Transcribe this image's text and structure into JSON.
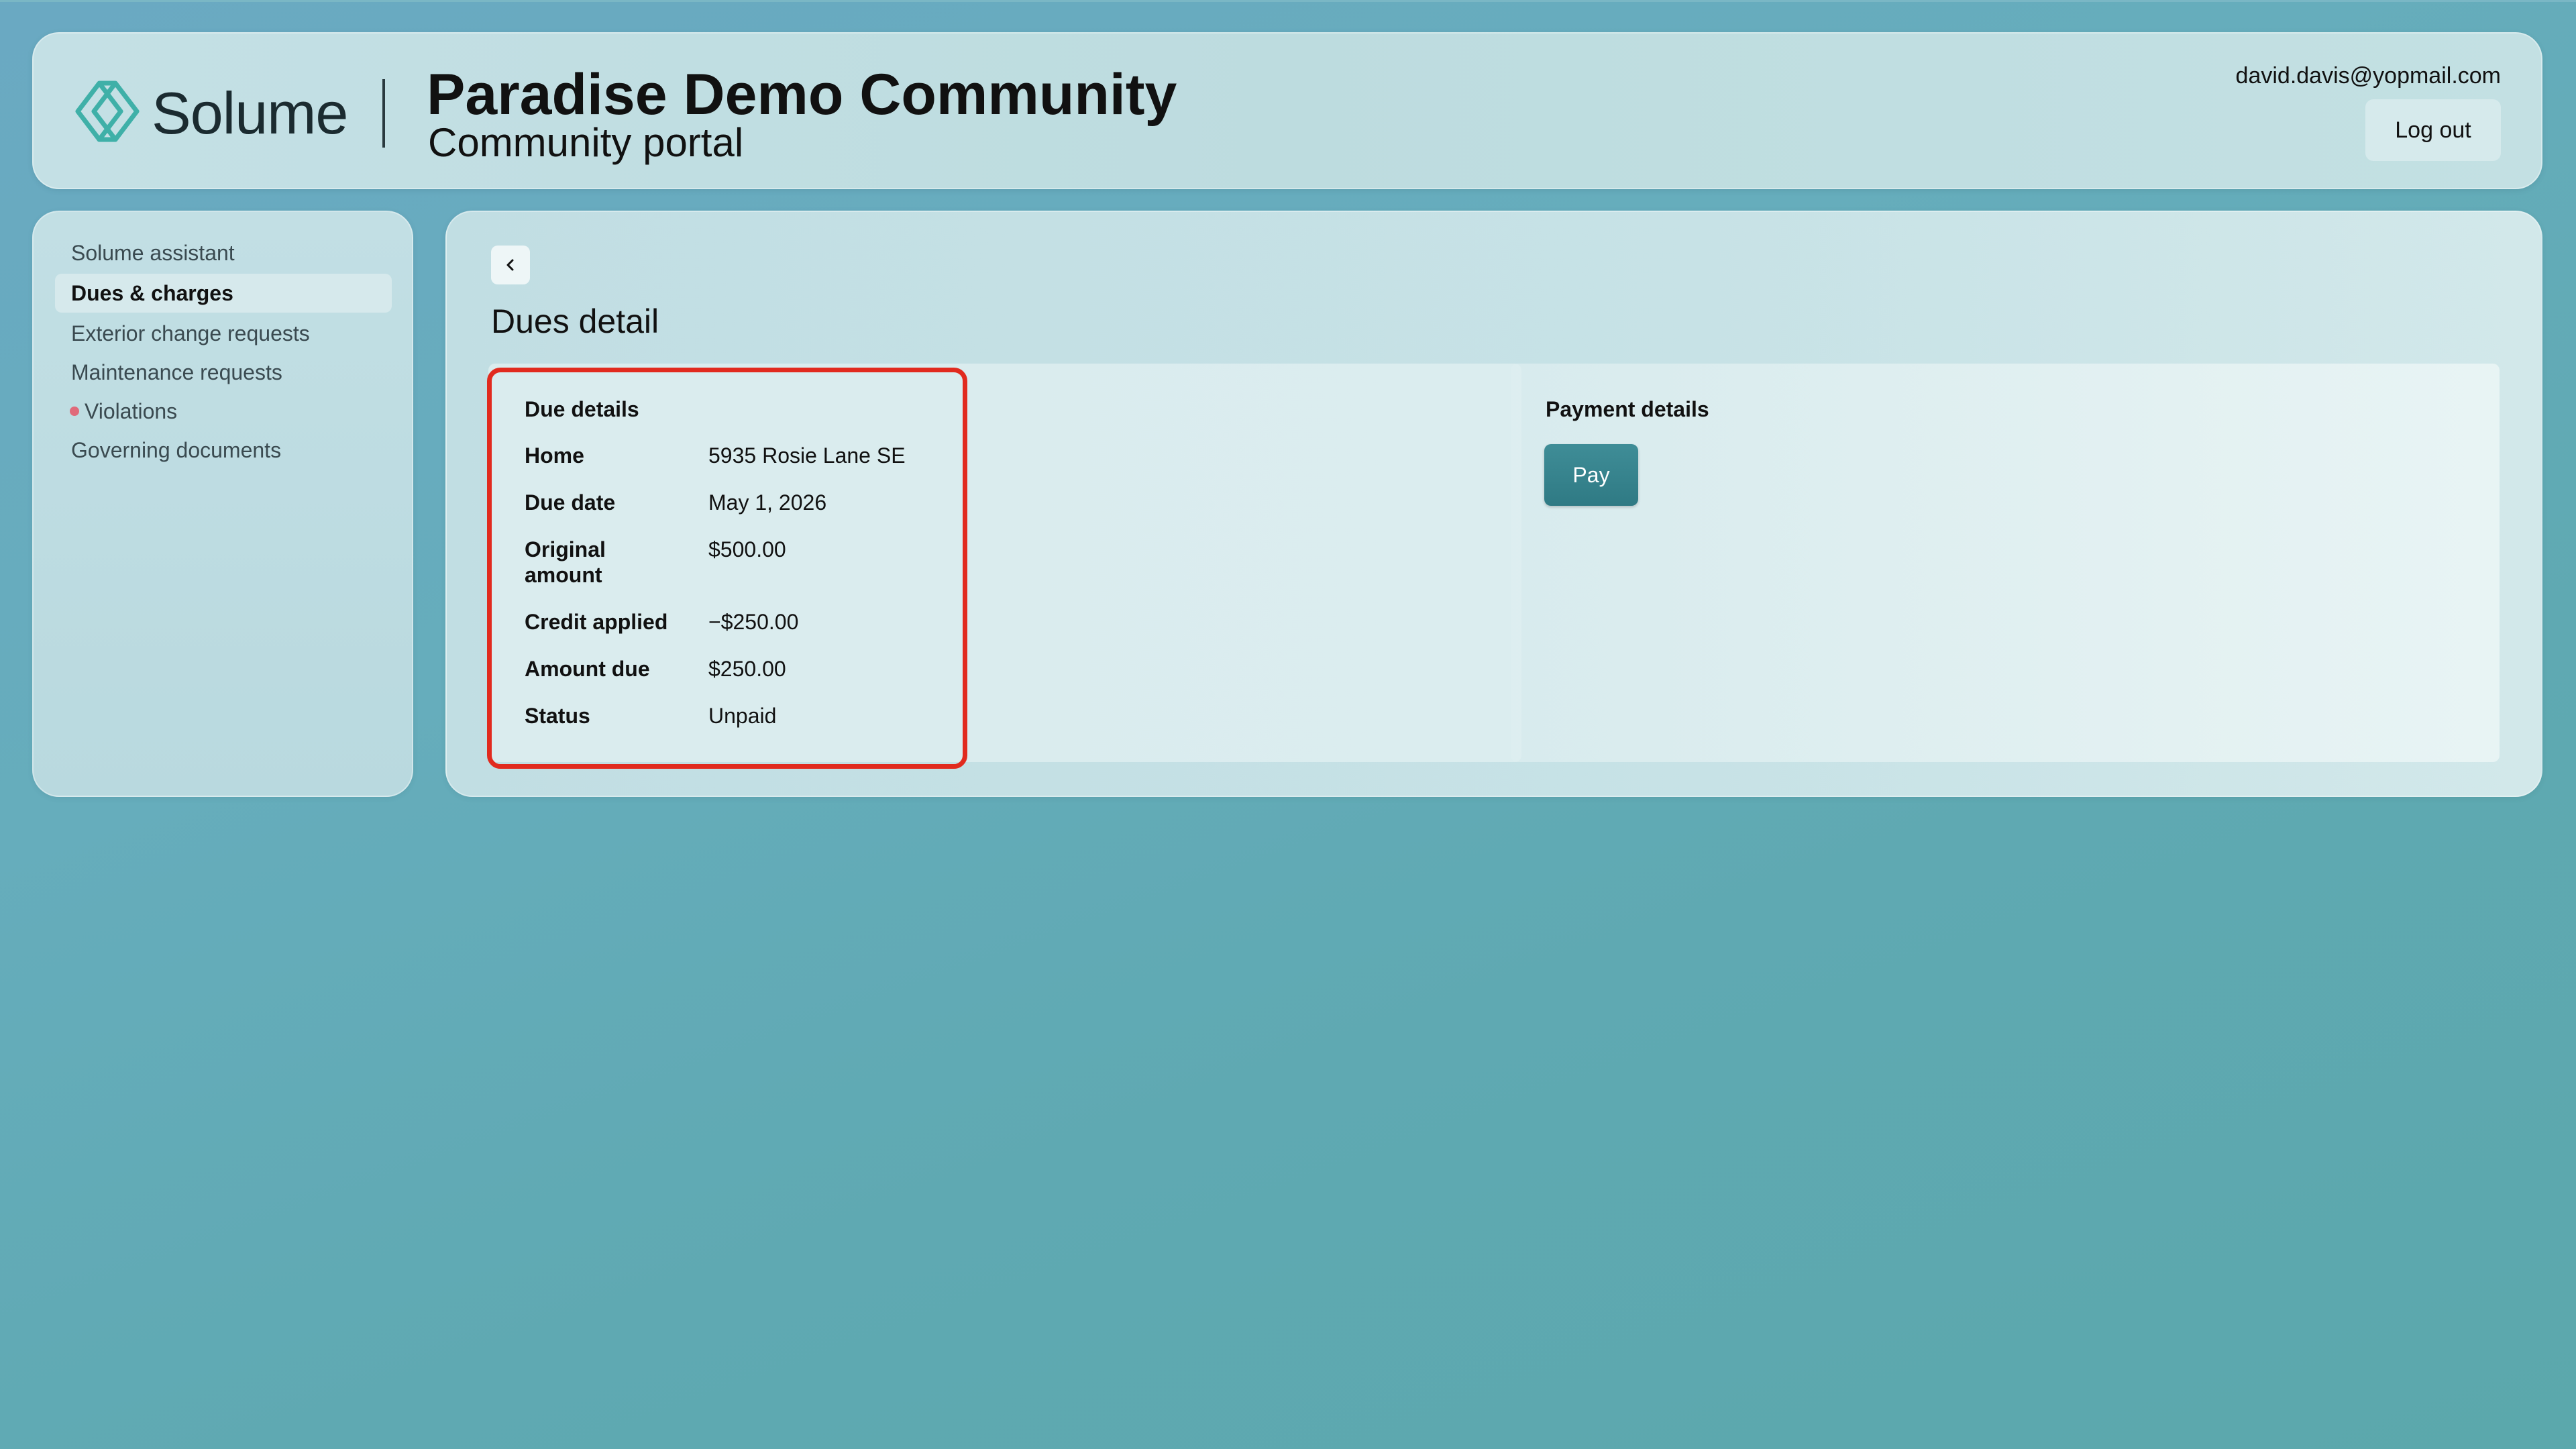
{
  "header": {
    "brand": "Solume",
    "community_name": "Paradise Demo Community",
    "portal_label": "Community portal",
    "user_email": "david.davis@yopmail.com",
    "logout_label": "Log out"
  },
  "sidebar": {
    "items": [
      {
        "label": "Solume assistant",
        "active": false
      },
      {
        "label": "Dues & charges",
        "active": true
      },
      {
        "label": "Exterior change requests",
        "active": false
      },
      {
        "label": "Maintenance requests",
        "active": false
      },
      {
        "label": "Violations",
        "active": false,
        "has_alert_dot": true
      },
      {
        "label": "Governing documents",
        "active": false
      }
    ]
  },
  "main": {
    "back_icon": "chevron-left-icon",
    "page_title": "Dues detail",
    "due_details": {
      "heading": "Due details",
      "rows": [
        {
          "label": "Home",
          "value": "5935 Rosie Lane SE"
        },
        {
          "label": "Due date",
          "value": "May 1, 2026"
        },
        {
          "label": "Original amount",
          "value": "$500.00"
        },
        {
          "label": "Credit applied",
          "value": "−$250.00"
        },
        {
          "label": "Amount due",
          "value": "$250.00"
        },
        {
          "label": "Status",
          "value": "Unpaid"
        }
      ]
    },
    "payment_details": {
      "heading": "Payment details",
      "pay_label": "Pay"
    }
  },
  "colors": {
    "accent": "#2f7a84",
    "highlight_border": "#e12a1e",
    "alert_dot": "#e06a7a"
  }
}
